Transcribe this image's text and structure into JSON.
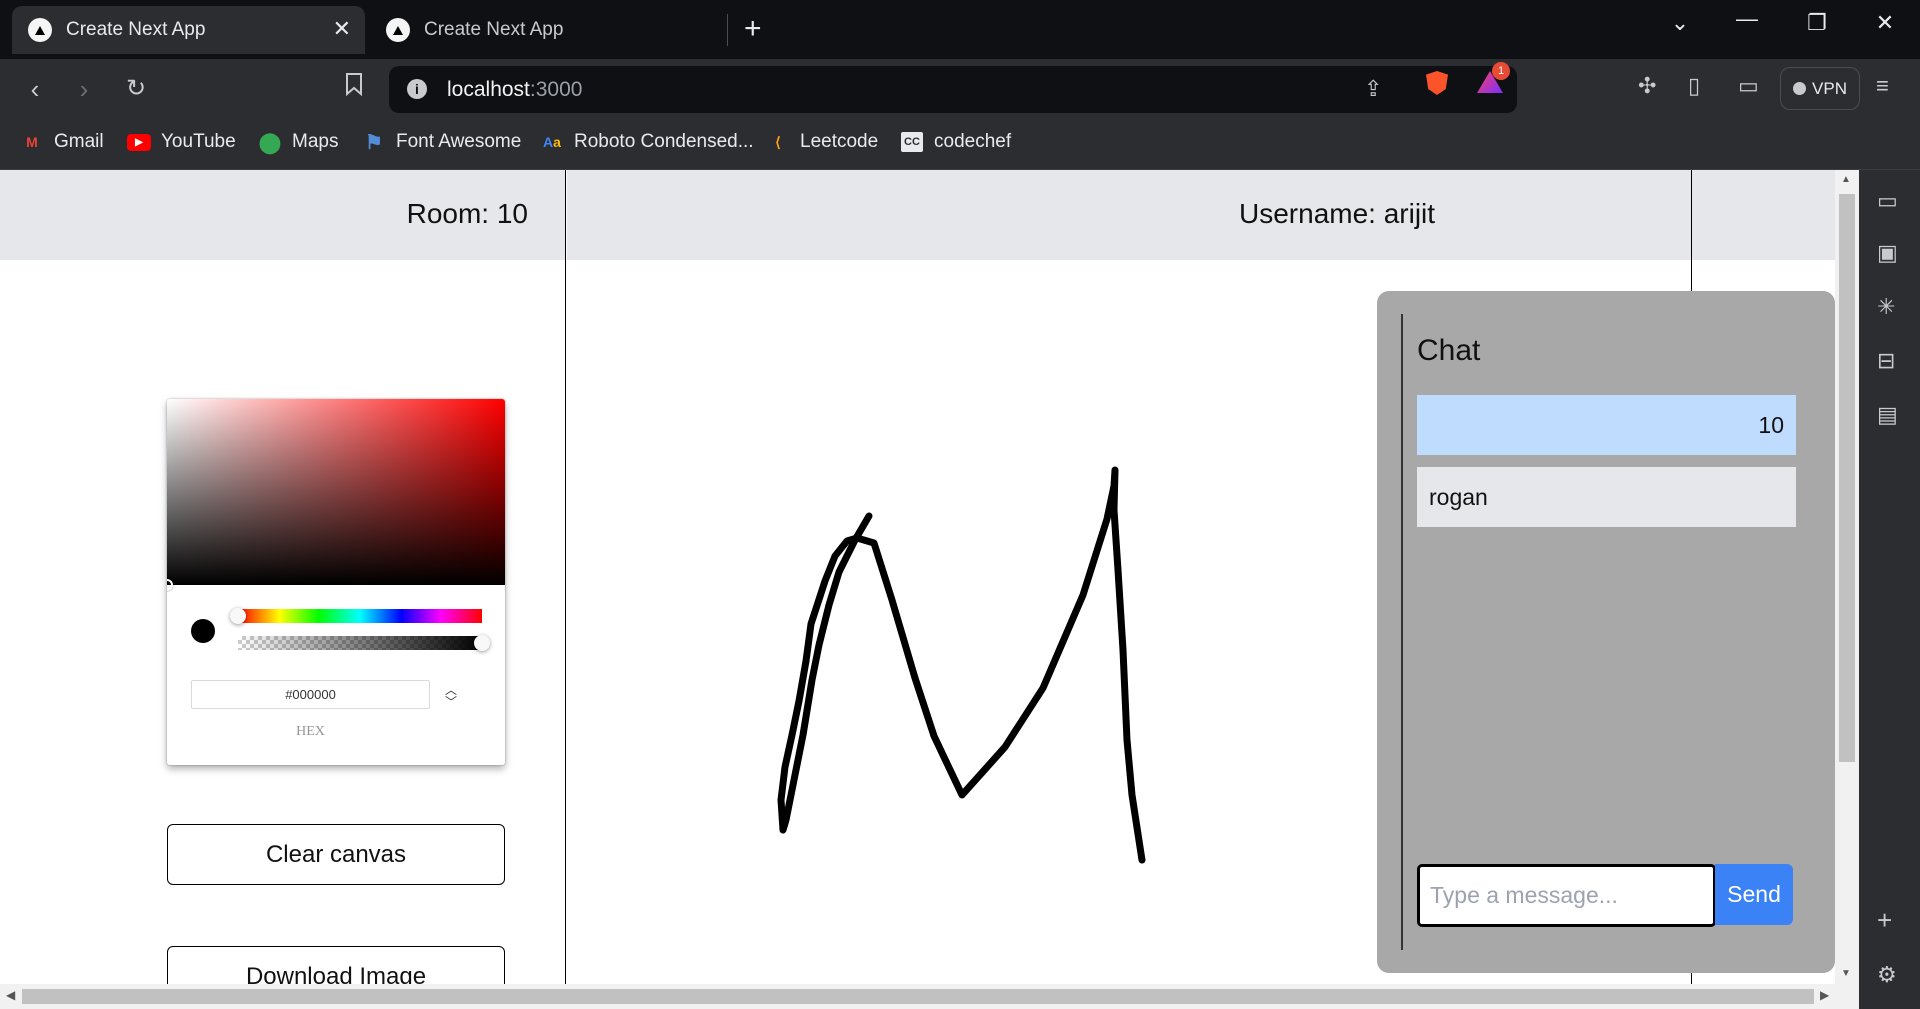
{
  "browser": {
    "tabs": [
      {
        "title": "Create Next App",
        "active": true
      },
      {
        "title": "Create Next App",
        "active": false
      }
    ],
    "url_host": "localhost",
    "url_port": ":3000",
    "shields_badge": "1",
    "vpn_label": "VPN",
    "bookmarks": [
      {
        "label": "Gmail",
        "icon": "gmail-icon"
      },
      {
        "label": "YouTube",
        "icon": "youtube-icon"
      },
      {
        "label": "Maps",
        "icon": "maps-icon"
      },
      {
        "label": "Font Awesome",
        "icon": "flag-icon"
      },
      {
        "label": "Roboto Condensed...",
        "icon": "google-fonts-icon"
      },
      {
        "label": "Leetcode",
        "icon": "leetcode-icon"
      },
      {
        "label": "codechef",
        "icon": "codechef-icon"
      }
    ]
  },
  "page": {
    "room_label": "Room: 10",
    "username_label": "Username: arijit",
    "color_picker": {
      "hex_value": "#000000",
      "mode_label": "HEX",
      "selected_color": "#000000",
      "hue_position": 0,
      "alpha": 1
    },
    "buttons": {
      "clear": "Clear canvas",
      "download": "Download Image"
    },
    "canvas": {
      "stroke_color": "#000000",
      "drawing": "freehand letter M"
    },
    "chat": {
      "title": "Chat",
      "messages": [
        {
          "text": "10",
          "mine": true
        },
        {
          "text": "rogan",
          "mine": false
        }
      ],
      "input_placeholder": "Type a message...",
      "input_value": "",
      "send_label": "Send"
    }
  },
  "colors": {
    "header_bg": "#e5e7eb",
    "chat_bg": "#a8a8a8",
    "my_message_bg": "#bfdbfe",
    "other_message_bg": "#e5e7eb",
    "send_button": "#3b82f6",
    "browser_dark": "#0f1013",
    "browser_toolbar": "#2b2d31"
  }
}
